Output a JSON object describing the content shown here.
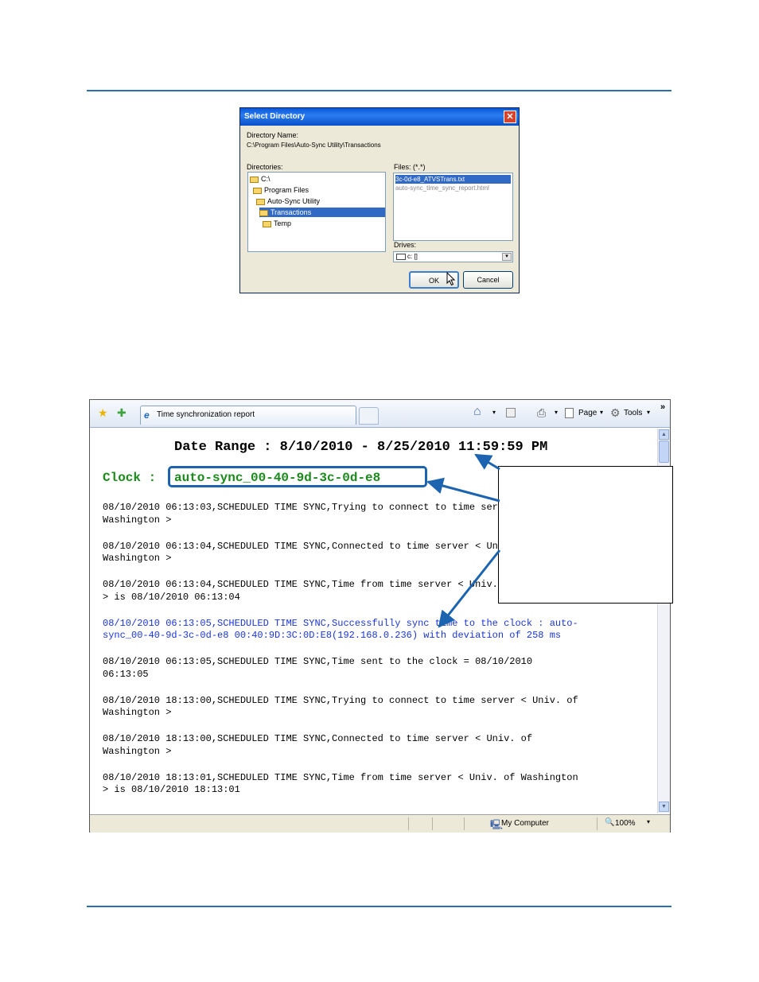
{
  "dialog": {
    "title": "Select Directory",
    "close_glyph": "✕",
    "directory_name_label": "Directory Name:",
    "directory_path": "C:\\Program Files\\Auto-Sync Utility\\Transactions",
    "directories_label": "Directories:",
    "directories": [
      {
        "label": "C:\\",
        "indent": 0,
        "selected": false
      },
      {
        "label": "Program Files",
        "indent": 1,
        "selected": false
      },
      {
        "label": "Auto-Sync Utility",
        "indent": 2,
        "selected": false
      },
      {
        "label": "Transactions",
        "indent": 3,
        "selected": true
      },
      {
        "label": "Temp",
        "indent": 4,
        "selected": false
      }
    ],
    "files_label": "Files: (*.*)",
    "files": [
      {
        "label": "3c-0d-e8_ATVSTrans.txt",
        "selected": true
      },
      {
        "label": "auto-sync_time_sync_report.html",
        "selected": false
      }
    ],
    "drives_label": "Drives:",
    "drive_value": "c: []",
    "ok_label": "OK",
    "cancel_label": "Cancel"
  },
  "browser": {
    "tab_title": "Time synchronization report",
    "home_label": "⌂",
    "page_label": "Page",
    "tools_label": "Tools",
    "overflow_label": "»",
    "status_zone": "My Computer",
    "zoom": "100%",
    "report": {
      "date_range": "Date Range : 8/10/2010 - 8/25/2010 11:59:59 PM",
      "clock_label": "Clock :",
      "clock_name": "auto-sync_00-40-9d-3c-0d-e8",
      "entries": [
        {
          "text": "08/10/2010 06:13:03,SCHEDULED TIME SYNC,Trying to connect to time server < Univ. of\nWashington >",
          "highlight": false
        },
        {
          "text": "08/10/2010 06:13:04,SCHEDULED TIME SYNC,Connected to time server < Univ. of\nWashington >",
          "highlight": false
        },
        {
          "text": "08/10/2010 06:13:04,SCHEDULED TIME SYNC,Time from time server < Univ. of Washington\n> is 08/10/2010 06:13:04",
          "highlight": false
        },
        {
          "text": "08/10/2010 06:13:05,SCHEDULED TIME SYNC,Successfully sync time to the clock : auto-\nsync_00-40-9d-3c-0d-e8 00:40:9D:3C:0D:E8(192.168.0.236) with deviation of 258 ms",
          "highlight": true
        },
        {
          "text": "08/10/2010 06:13:05,SCHEDULED TIME SYNC,Time sent to the clock = 08/10/2010\n06:13:05",
          "highlight": false
        },
        {
          "text": "08/10/2010 18:13:00,SCHEDULED TIME SYNC,Trying to connect to time server < Univ. of\nWashington >",
          "highlight": false
        },
        {
          "text": "08/10/2010 18:13:00,SCHEDULED TIME SYNC,Connected to time server < Univ. of\nWashington >",
          "highlight": false
        },
        {
          "text": "08/10/2010 18:13:01,SCHEDULED TIME SYNC,Time from time server < Univ. of Washington\n> is 08/10/2010 18:13:01",
          "highlight": false
        }
      ]
    }
  },
  "colors": {
    "rule": "#2a6fb0",
    "clock_green": "#1a8a1a",
    "highlight_blue": "#1a36d8",
    "annotation_blue": "#1c63b0"
  }
}
